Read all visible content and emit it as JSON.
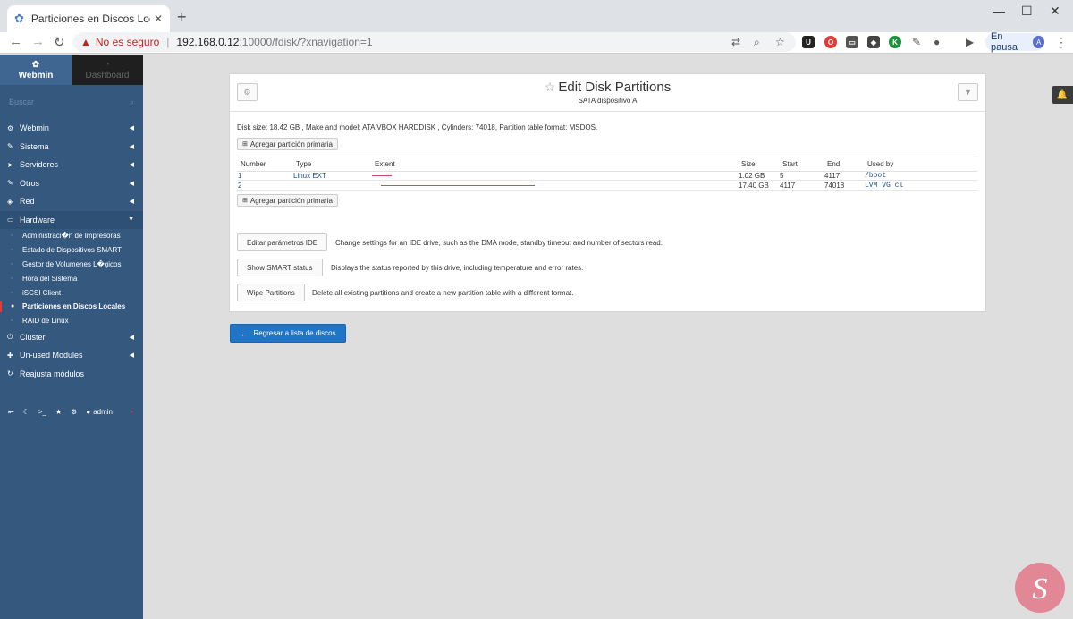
{
  "browser": {
    "tab_title": "Particiones en Discos Locales/Edi",
    "security_label": "No es seguro",
    "url_host": "192.168.0.12",
    "url_path": ":10000/fdisk/?xnavigation=1",
    "profile_status": "En pausa",
    "profile_initial": "A"
  },
  "sidebar": {
    "tab_webmin": "Webmin",
    "tab_dashboard": "Dashboard",
    "search_placeholder": "Buscar",
    "menu": [
      {
        "label": "Webmin",
        "icon": "gear-icon"
      },
      {
        "label": "Sistema",
        "icon": "wrench-icon"
      },
      {
        "label": "Servidores",
        "icon": "rocket-icon"
      },
      {
        "label": "Otros",
        "icon": "wrench-icon"
      },
      {
        "label": "Red",
        "icon": "shield-icon"
      },
      {
        "label": "Hardware",
        "icon": "hdd-icon"
      }
    ],
    "hardware_items": [
      "Administraci�n de Impresoras",
      "Estado de Dispositivos SMART",
      "Gestor de Volumenes L�gicos",
      "Hora del Sistema",
      "iSCSI Client",
      "Particiones en Discos Locales",
      "RAID de Linux"
    ],
    "menu_after": [
      {
        "label": "Cluster",
        "icon": "power-icon"
      },
      {
        "label": "Un-used Modules",
        "icon": "puzzle-icon"
      },
      {
        "label": "Reajusta módulos",
        "icon": "refresh-icon"
      }
    ],
    "user": "admin"
  },
  "panel": {
    "title": "Edit Disk Partitions",
    "subtitle": "SATA dispositivo A",
    "disk_size_label": "Disk size:",
    "disk_size": "18.42 GB",
    "make_label": "Make and model:",
    "make": "ATA VBOX HARDDISK",
    "cylinders_label": "Cylinders:",
    "cylinders": "74018",
    "table_format_label": "Partition table format:",
    "table_format": "MSDOS",
    "add_primary": "Agregar partición primaria",
    "columns": [
      "Number",
      "Type",
      "Extent",
      "Size",
      "Start",
      "End",
      "Used by"
    ],
    "partitions": [
      {
        "number": "1",
        "type": "Linux EXT",
        "extent_fraction": 0.055,
        "extent_offset": 0,
        "size": "1.02 GB",
        "start": "5",
        "end": "4117",
        "used_by": "/boot"
      },
      {
        "number": "2",
        "type": "",
        "extent_fraction": 0.43,
        "extent_offset": 0.025,
        "size": "17.40 GB",
        "start": "4117",
        "end": "74018",
        "used_by": "LVM VG  cl"
      }
    ],
    "actions": [
      {
        "label": "Editar parámetros IDE",
        "desc": "Change settings for an IDE drive, such as the DMA mode, standby timeout and number of sectors read."
      },
      {
        "label": "Show SMART status",
        "desc": "Displays the status reported by this drive, including temperature and error rates."
      },
      {
        "label": "Wipe Partitions",
        "desc": "Delete all existing partitions and create a new partition table with a different format."
      }
    ]
  },
  "back_button": "Regresar a lista de discos",
  "colors": {
    "sidebar": "#34587e",
    "accent": "#2175c7",
    "extent_bar": "#d9485f",
    "watermark": "#e3405a"
  }
}
